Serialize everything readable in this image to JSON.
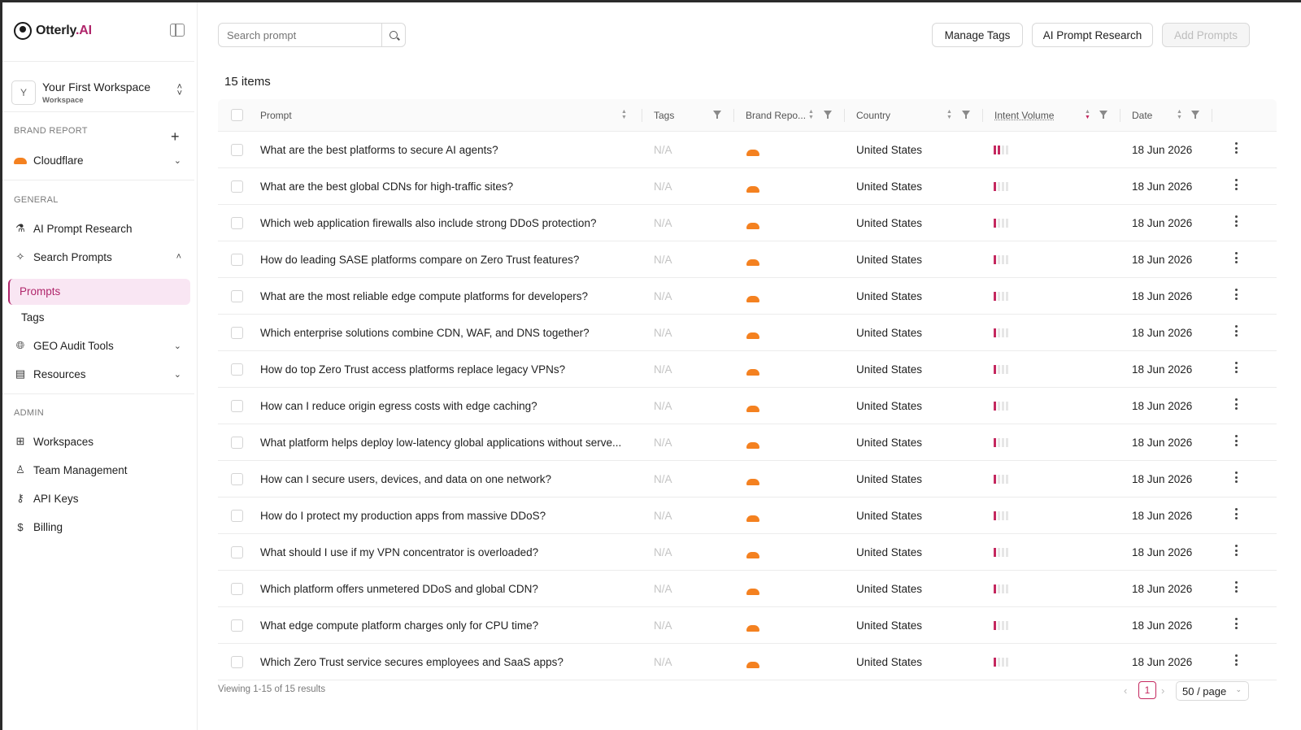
{
  "app": {
    "brand": "Otterly",
    "brand_suffix": ".AI"
  },
  "sidebar": {
    "workspace": {
      "avatar": "Y",
      "name": "Your First Workspace",
      "sub": "Workspace"
    },
    "brand_report_label": "BRAND REPORT",
    "brand": {
      "name": "Cloudflare"
    },
    "general_label": "GENERAL",
    "general_items": [
      {
        "label": "AI Prompt Research",
        "icon": "flask-icon"
      },
      {
        "label": "Search Prompts",
        "icon": "sparkle-icon"
      }
    ],
    "sub_items": [
      "Prompts",
      "Tags"
    ],
    "more_items": [
      {
        "label": "GEO Audit Tools",
        "icon": "globe-icon"
      },
      {
        "label": "Resources",
        "icon": "book-icon"
      }
    ],
    "admin_label": "ADMIN",
    "admin_items": [
      {
        "label": "Workspaces",
        "icon": "grid-icon"
      },
      {
        "label": "Team Management",
        "icon": "team-icon"
      },
      {
        "label": "API Keys",
        "icon": "key-icon"
      },
      {
        "label": "Billing",
        "icon": "dollar-icon"
      }
    ]
  },
  "toolbar": {
    "search_placeholder": "Search prompt",
    "manage_tags": "Manage Tags",
    "ai_prompt_research": "AI Prompt Research",
    "add_prompts": "Add Prompts"
  },
  "items_count": "15 items",
  "table": {
    "columns": [
      "Prompt",
      "Tags",
      "Brand Repo...",
      "Country",
      "Intent Volume",
      "Date"
    ],
    "rows": [
      {
        "prompt": "What are the best platforms to secure AI agents?",
        "tags": "N/A",
        "country": "United States",
        "intent_level": 2,
        "date": "18 Jun 2026"
      },
      {
        "prompt": "What are the best global CDNs for high-traffic sites?",
        "tags": "N/A",
        "country": "United States",
        "intent_level": 1,
        "date": "18 Jun 2026"
      },
      {
        "prompt": "Which web application firewalls also include strong DDoS protection?",
        "tags": "N/A",
        "country": "United States",
        "intent_level": 1,
        "date": "18 Jun 2026"
      },
      {
        "prompt": "How do leading SASE platforms compare on Zero Trust features?",
        "tags": "N/A",
        "country": "United States",
        "intent_level": 1,
        "date": "18 Jun 2026"
      },
      {
        "prompt": "What are the most reliable edge compute platforms for developers?",
        "tags": "N/A",
        "country": "United States",
        "intent_level": 1,
        "date": "18 Jun 2026"
      },
      {
        "prompt": "Which enterprise solutions combine CDN, WAF, and DNS together?",
        "tags": "N/A",
        "country": "United States",
        "intent_level": 1,
        "date": "18 Jun 2026"
      },
      {
        "prompt": "How do top Zero Trust access platforms replace legacy VPNs?",
        "tags": "N/A",
        "country": "United States",
        "intent_level": 1,
        "date": "18 Jun 2026"
      },
      {
        "prompt": "How can I reduce origin egress costs with edge caching?",
        "tags": "N/A",
        "country": "United States",
        "intent_level": 1,
        "date": "18 Jun 2026"
      },
      {
        "prompt": "What platform helps deploy low-latency global applications without serve...",
        "tags": "N/A",
        "country": "United States",
        "intent_level": 1,
        "date": "18 Jun 2026"
      },
      {
        "prompt": "How can I secure users, devices, and data on one network?",
        "tags": "N/A",
        "country": "United States",
        "intent_level": 1,
        "date": "18 Jun 2026"
      },
      {
        "prompt": "How do I protect my production apps from massive DDoS?",
        "tags": "N/A",
        "country": "United States",
        "intent_level": 1,
        "date": "18 Jun 2026"
      },
      {
        "prompt": "What should I use if my VPN concentrator is overloaded?",
        "tags": "N/A",
        "country": "United States",
        "intent_level": 1,
        "date": "18 Jun 2026"
      },
      {
        "prompt": "Which platform offers unmetered DDoS and global CDN?",
        "tags": "N/A",
        "country": "United States",
        "intent_level": 1,
        "date": "18 Jun 2026"
      },
      {
        "prompt": "What edge compute platform charges only for CPU time?",
        "tags": "N/A",
        "country": "United States",
        "intent_level": 1,
        "date": "18 Jun 2026"
      },
      {
        "prompt": "Which Zero Trust service secures employees and SaaS apps?",
        "tags": "N/A",
        "country": "United States",
        "intent_level": 1,
        "date": "18 Jun 2026"
      }
    ]
  },
  "footer": {
    "viewing": "Viewing 1-15 of 15 results",
    "current_page": "1",
    "page_size": "50 / page"
  },
  "colors": {
    "accent": "#b0266b",
    "intent_bar": "#c4285f",
    "brand_logo": "#f48120"
  }
}
